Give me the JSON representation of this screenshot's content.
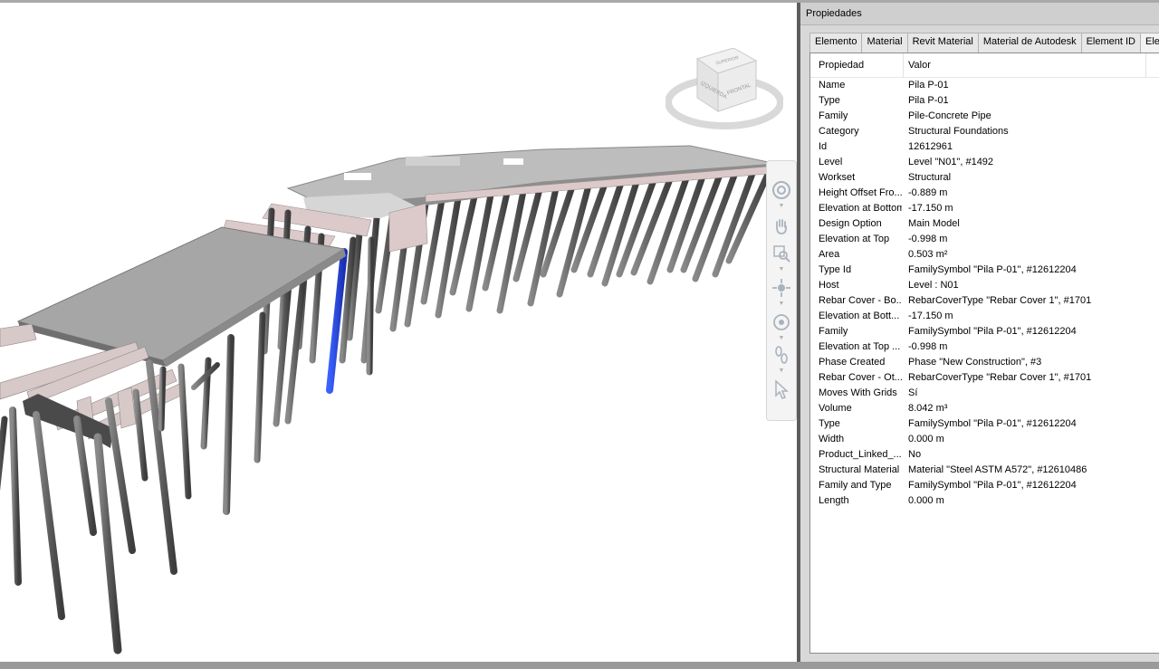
{
  "panel": {
    "title": "Propiedades",
    "tabs": [
      "Elemento",
      "Material",
      "Revit Material",
      "Material de Autodesk",
      "Element ID",
      "Elem"
    ],
    "columns": {
      "property": "Propiedad",
      "value": "Valor"
    },
    "rows": [
      {
        "k": "Name",
        "v": "Pila P-01"
      },
      {
        "k": "Type",
        "v": "Pila P-01"
      },
      {
        "k": "Family",
        "v": "Pile-Concrete Pipe"
      },
      {
        "k": "Category",
        "v": "Structural Foundations"
      },
      {
        "k": "Id",
        "v": "12612961"
      },
      {
        "k": "Level",
        "v": "Level \"N01\", #1492"
      },
      {
        "k": "Workset",
        "v": "Structural"
      },
      {
        "k": "Height Offset Fro...",
        "v": "-0.889 m"
      },
      {
        "k": "Elevation at Bottom",
        "v": "-17.150 m"
      },
      {
        "k": "Design Option",
        "v": "Main Model"
      },
      {
        "k": "Elevation at Top",
        "v": "-0.998 m"
      },
      {
        "k": "Area",
        "v": "0.503 m²"
      },
      {
        "k": "Type Id",
        "v": "FamilySymbol \"Pila P-01\", #12612204"
      },
      {
        "k": "Host",
        "v": "Level : N01"
      },
      {
        "k": "Rebar Cover - Bo...",
        "v": "RebarCoverType \"Rebar Cover 1\", #1701"
      },
      {
        "k": "Elevation at Bott...",
        "v": "-17.150 m"
      },
      {
        "k": "Family",
        "v": "FamilySymbol \"Pila P-01\", #12612204"
      },
      {
        "k": "Elevation at Top ...",
        "v": "-0.998 m"
      },
      {
        "k": "Phase Created",
        "v": "Phase \"New Construction\", #3"
      },
      {
        "k": "Rebar Cover - Ot...",
        "v": "RebarCoverType \"Rebar Cover 1\", #1701"
      },
      {
        "k": "Moves With Grids",
        "v": "Sí"
      },
      {
        "k": "Volume",
        "v": "8.042 m³"
      },
      {
        "k": "Type",
        "v": "FamilySymbol \"Pila P-01\", #12612204"
      },
      {
        "k": "Width",
        "v": "0.000 m"
      },
      {
        "k": "Product_Linked_...",
        "v": "No"
      },
      {
        "k": "Structural Material",
        "v": "Material \"Steel ASTM A572\", #12610486"
      },
      {
        "k": "Family and Type",
        "v": "FamilySymbol \"Pila P-01\", #12612204"
      },
      {
        "k": "Length",
        "v": "0.000 m"
      }
    ]
  },
  "viewcube": {
    "faces": [
      "IZQUIERDA",
      "FRONTAL",
      "SUPERIOR"
    ]
  },
  "navigation_bar": {
    "tools": [
      "steering-wheel-icon",
      "pan-hand-icon",
      "zoom-icon",
      "orbit-icon",
      "center-icon",
      "walk-icon",
      "select-arrow-icon"
    ]
  },
  "colors": {
    "selected_pile": "#1f3fd1",
    "pile": "#6e6e6e",
    "deck": "#a4a4a4",
    "beam": "#d9c9c9",
    "panel_bg": "#d8d8d8"
  }
}
